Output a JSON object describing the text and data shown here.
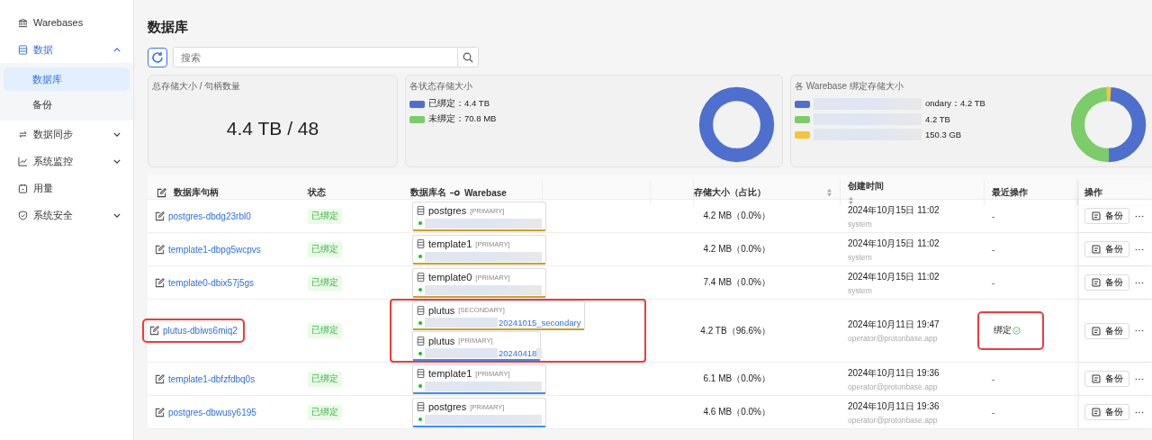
{
  "sidebar": {
    "items": [
      {
        "label": "Warebases"
      },
      {
        "label": "数据",
        "expanded": true,
        "children": [
          {
            "label": "数据库",
            "selected": true
          },
          {
            "label": "备份",
            "selected": false
          }
        ]
      },
      {
        "label": "数据同步",
        "expanded": false
      },
      {
        "label": "系统监控",
        "expanded": false
      },
      {
        "label": "用量"
      },
      {
        "label": "系统安全",
        "expanded": false
      }
    ]
  },
  "page_title": "数据库",
  "search": {
    "placeholder": "搜索"
  },
  "summary_cards": [
    {
      "kind": "total",
      "title": "总存储大小 / 句柄数量",
      "value": "4.4 TB / 48"
    },
    {
      "kind": "status_legend",
      "title": "各状态存储大小",
      "legend": [
        {
          "text": "已绑定：4.4 TB",
          "color": "#4f6fce"
        },
        {
          "text": "未绑定：70.8 MB",
          "color": "#7ccc6a"
        }
      ]
    },
    {
      "kind": "warebase_legend",
      "title": "各 Warebase 绑定存储大小",
      "legend": [
        {
          "text": "ondary：4.2 TB",
          "color": "#4f6fce"
        },
        {
          "text": "4.2 TB",
          "color": "#7ccc6a"
        },
        {
          "text": "150.3 GB",
          "color": "#f8c437"
        }
      ]
    }
  ],
  "table": {
    "columns": [
      "数据库句柄",
      "状态",
      "数据库名",
      "Warebase",
      "存储大小（占比）",
      "创建时间",
      "最近操作",
      "操作"
    ],
    "rows": [
      {
        "handle": "postgres-dbdg23rbl0",
        "status": "已绑定",
        "databases": [
          {
            "name": "postgres",
            "tag": "[PRIMARY]",
            "color": "#c9a227"
          }
        ],
        "size": "4.2 MB（0.0%）",
        "created": "2024年10月15日 11:02",
        "creator": "system",
        "recent": {
          "kind": "none",
          "text": "-"
        },
        "action": "备份",
        "annotated": false
      },
      {
        "handle": "template1-dbpg5wcpvs",
        "status": "已绑定",
        "databases": [
          {
            "name": "template1",
            "tag": "[PRIMARY]",
            "color": "#c9a227"
          }
        ],
        "size": "4.2 MB（0.0%）",
        "created": "2024年10月15日 11:02",
        "creator": "system",
        "recent": {
          "kind": "none",
          "text": "-"
        },
        "action": "备份",
        "annotated": false
      },
      {
        "handle": "template0-dbix57j5gs",
        "status": "已绑定",
        "databases": [
          {
            "name": "template0",
            "tag": "[PRIMARY]",
            "color": "#c9a227"
          }
        ],
        "size": "7.4 MB（0.0%）",
        "created": "2024年10月15日 11:02",
        "creator": "system",
        "recent": {
          "kind": "none",
          "text": "-"
        },
        "action": "备份",
        "annotated": false
      },
      {
        "handle": "plutus-dbiws6miq2",
        "status": "已绑定",
        "databases": [
          {
            "name": "plutus",
            "tag": "[SECONDARY]",
            "suffix": "20241015_secondary",
            "color": "#c9a227"
          },
          {
            "name": "plutus",
            "tag": "[PRIMARY]",
            "suffix": "20240418",
            "color": "#3b8ef0"
          }
        ],
        "size": "4.2 TB（96.6%）",
        "created": "2024年10月11日 19:47",
        "creator": "operator@protonbase.app",
        "recent": {
          "kind": "done",
          "text": "绑定"
        },
        "action": "备份",
        "annotated": true
      },
      {
        "handle": "template1-dbfzfdbq0s",
        "status": "已绑定",
        "databases": [
          {
            "name": "template1",
            "tag": "[PRIMARY]",
            "color": "#3b8ef0"
          }
        ],
        "size": "6.1 MB（0.0%）",
        "created": "2024年10月11日 19:36",
        "creator": "operator@protonbase.app",
        "recent": {
          "kind": "none",
          "text": "-"
        },
        "action": "备份",
        "annotated": false
      },
      {
        "handle": "postgres-dbwusy6195",
        "status": "已绑定",
        "databases": [
          {
            "name": "postgres",
            "tag": "[PRIMARY]",
            "color": "#3b8ef0"
          }
        ],
        "size": "4.6 MB（0.0%）",
        "created": "2024年10月11日 19:36",
        "creator": "operator@protonbase.app",
        "recent": {
          "kind": "none",
          "text": "-"
        },
        "action": "备份",
        "annotated": false
      }
    ]
  }
}
